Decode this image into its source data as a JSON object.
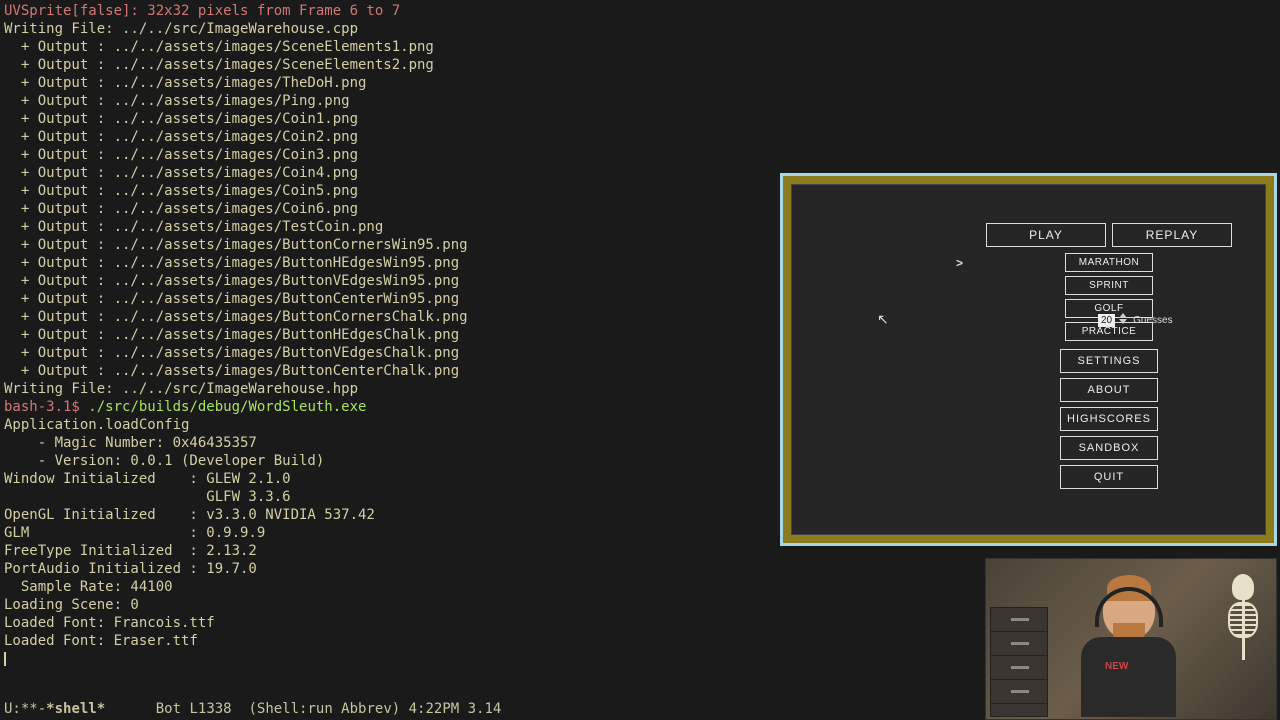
{
  "terminal": {
    "line1": "UVSprite[false]: 32x32 pixels from Frame 6 to 7",
    "line2": "Writing File: ../../src/ImageWarehouse.cpp",
    "outputs": [
      "  + Output : ../../assets/images/SceneElements1.png",
      "  + Output : ../../assets/images/SceneElements2.png",
      "  + Output : ../../assets/images/TheDoH.png",
      "  + Output : ../../assets/images/Ping.png",
      "  + Output : ../../assets/images/Coin1.png",
      "  + Output : ../../assets/images/Coin2.png",
      "  + Output : ../../assets/images/Coin3.png",
      "  + Output : ../../assets/images/Coin4.png",
      "  + Output : ../../assets/images/Coin5.png",
      "  + Output : ../../assets/images/Coin6.png",
      "  + Output : ../../assets/images/TestCoin.png",
      "  + Output : ../../assets/images/ButtonCornersWin95.png",
      "  + Output : ../../assets/images/ButtonHEdgesWin95.png",
      "  + Output : ../../assets/images/ButtonVEdgesWin95.png",
      "  + Output : ../../assets/images/ButtonCenterWin95.png",
      "  + Output : ../../assets/images/ButtonCornersChalk.png",
      "  + Output : ../../assets/images/ButtonHEdgesChalk.png",
      "  + Output : ../../assets/images/ButtonVEdgesChalk.png",
      "  + Output : ../../assets/images/ButtonCenterChalk.png"
    ],
    "line3": "Writing File: ../../src/ImageWarehouse.hpp",
    "prompt": "bash-3.1$ ",
    "cmd": "./src/builds/debug/WordSleuth.exe",
    "startup": [
      "Application.loadConfig",
      "    - Magic Number: 0x46435357",
      "    - Version: 0.0.1 (Developer Build)",
      "Window Initialized    : GLEW 2.1.0",
      "                        GLFW 3.3.6",
      "OpenGL Initialized    : v3.3.0 NVIDIA 537.42",
      "GLM                   : 0.9.9.9",
      "FreeType Initialized  : 2.13.2",
      "PortAudio Initialized : 19.7.0",
      "  Sample Rate: 44100",
      "Loading Scene: 0",
      "Loaded Font: Francois.ttf",
      "Loaded Font: Eraser.ttf"
    ]
  },
  "statusbar": {
    "left": "U:**-",
    "buffer": "*shell*",
    "right": "      Bot L1338  (Shell:run Abbrev) 4:22PM 3.14"
  },
  "game": {
    "play": "PLAY",
    "replay": "REPLAY",
    "marathon": "MARATHON",
    "sprint": "SPRINT",
    "golf": "GOLF",
    "practice": "PRACTICE",
    "guesses_num": "20",
    "guesses_label": "Guesses",
    "settings": "SETTINGS",
    "about": "ABOUT",
    "highscores": "HIGHSCORES",
    "sandbox": "SANDBOX",
    "quit": "QUIT",
    "caret": ">"
  },
  "webcam": {
    "shirt": "NEW"
  }
}
